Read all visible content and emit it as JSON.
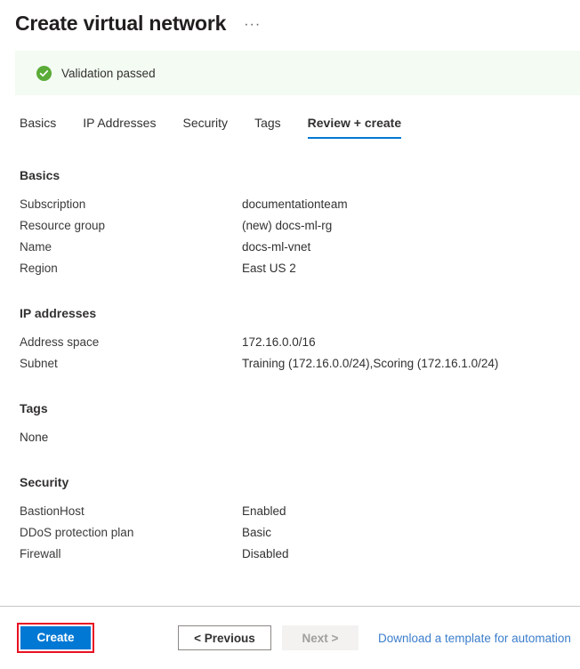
{
  "header": {
    "title": "Create virtual network",
    "more_options": "···"
  },
  "validation": {
    "text": "Validation passed",
    "icon": "check-circle-icon",
    "background_color": "#f3fbf2",
    "icon_color": "#5aab37"
  },
  "tabs": [
    {
      "label": "Basics",
      "active": false
    },
    {
      "label": "IP Addresses",
      "active": false
    },
    {
      "label": "Security",
      "active": false
    },
    {
      "label": "Tags",
      "active": false
    },
    {
      "label": "Review + create",
      "active": true
    }
  ],
  "sections": [
    {
      "title": "Basics",
      "rows": [
        {
          "label": "Subscription",
          "value": "documentationteam"
        },
        {
          "label": "Resource group",
          "value": "(new) docs-ml-rg"
        },
        {
          "label": "Name",
          "value": "docs-ml-vnet"
        },
        {
          "label": "Region",
          "value": "East US 2"
        }
      ]
    },
    {
      "title": "IP addresses",
      "rows": [
        {
          "label": "Address space",
          "value": "172.16.0.0/16"
        },
        {
          "label": "Subnet",
          "value": "Training (172.16.0.0/24),Scoring (172.16.1.0/24)"
        }
      ]
    },
    {
      "title": "Tags",
      "text": "None",
      "rows": []
    },
    {
      "title": "Security",
      "rows": [
        {
          "label": "BastionHost",
          "value": "Enabled"
        },
        {
          "label": "DDoS protection plan",
          "value": "Basic"
        },
        {
          "label": "Firewall",
          "value": "Disabled"
        }
      ]
    }
  ],
  "footer": {
    "create_label": "Create",
    "previous_label": "< Previous",
    "next_label": "Next >",
    "download_label": "Download a template for automation",
    "highlight_color": "#e81123",
    "primary_color": "#0078d4",
    "link_color": "#3b7ecb"
  }
}
